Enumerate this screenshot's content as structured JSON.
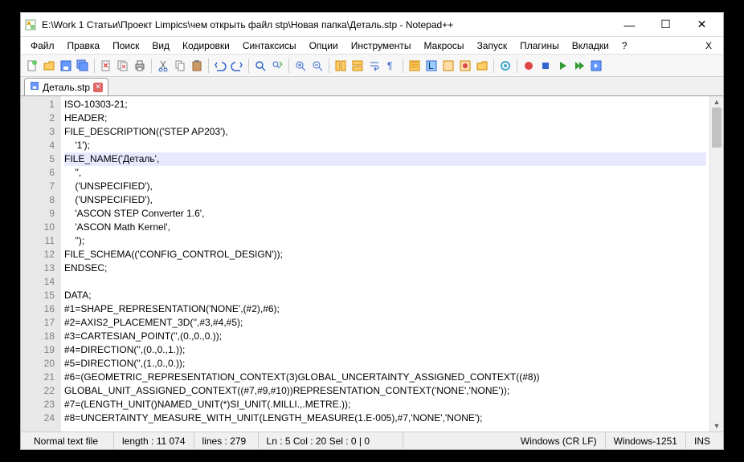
{
  "title": "E:\\Work 1 Статьи\\Проект Limpics\\чем открыть файл stp\\Новая папка\\Деталь.stp - Notepad++",
  "menu": [
    "Файл",
    "Правка",
    "Поиск",
    "Вид",
    "Кодировки",
    "Синтаксисы",
    "Опции",
    "Инструменты",
    "Макросы",
    "Запуск",
    "Плагины",
    "Вкладки",
    "?"
  ],
  "menu_x": "X",
  "tab": {
    "label": "Деталь.stp"
  },
  "lines": [
    {
      "n": "1",
      "t": "ISO-10303-21;"
    },
    {
      "n": "2",
      "t": "HEADER;"
    },
    {
      "n": "3",
      "t": "FILE_DESCRIPTION(('STEP AP203'),"
    },
    {
      "n": "4",
      "t": "    '1');"
    },
    {
      "n": "5",
      "t": "FILE_NAME('Деталь',",
      "hl": true
    },
    {
      "n": "6",
      "t": "    '',"
    },
    {
      "n": "7",
      "t": "    ('UNSPECIFIED'),"
    },
    {
      "n": "8",
      "t": "    ('UNSPECIFIED'),"
    },
    {
      "n": "9",
      "t": "    'ASCON STEP Converter 1.6',"
    },
    {
      "n": "10",
      "t": "    'ASCON Math Kernel',"
    },
    {
      "n": "11",
      "t": "    '');"
    },
    {
      "n": "12",
      "t": "FILE_SCHEMA(('CONFIG_CONTROL_DESIGN'));"
    },
    {
      "n": "13",
      "t": "ENDSEC;"
    },
    {
      "n": "14",
      "t": ""
    },
    {
      "n": "15",
      "t": "DATA;"
    },
    {
      "n": "16",
      "t": "#1=SHAPE_REPRESENTATION('NONE',(#2),#6);"
    },
    {
      "n": "17",
      "t": "#2=AXIS2_PLACEMENT_3D('',#3,#4,#5);"
    },
    {
      "n": "18",
      "t": "#3=CARTESIAN_POINT('',(0.,0.,0.));"
    },
    {
      "n": "19",
      "t": "#4=DIRECTION('',(0.,0.,1.));"
    },
    {
      "n": "20",
      "t": "#5=DIRECTION('',(1.,0.,0.));"
    },
    {
      "n": "21",
      "t": "#6=(GEOMETRIC_REPRESENTATION_CONTEXT(3)GLOBAL_UNCERTAINTY_ASSIGNED_CONTEXT((#8))"
    },
    {
      "n": "22",
      "t": "GLOBAL_UNIT_ASSIGNED_CONTEXT((#7,#9,#10))REPRESENTATION_CONTEXT('NONE','NONE'));"
    },
    {
      "n": "23",
      "t": "#7=(LENGTH_UNIT()NAMED_UNIT(*)SI_UNIT(.MILLI.,.METRE.));"
    },
    {
      "n": "24",
      "t": "#8=UNCERTAINTY_MEASURE_WITH_UNIT(LENGTH_MEASURE(1.E-005),#7,'NONE','NONE');"
    }
  ],
  "status": {
    "filetype": "Normal text file",
    "length": "length : 11 074",
    "lines": "lines : 279",
    "pos": "Ln : 5    Col : 20    Sel : 0 | 0",
    "eol": "Windows (CR LF)",
    "enc": "Windows-1251",
    "mode": "INS"
  },
  "icons": {
    "minimize": "—",
    "maximize": "☐",
    "close": "✕"
  }
}
